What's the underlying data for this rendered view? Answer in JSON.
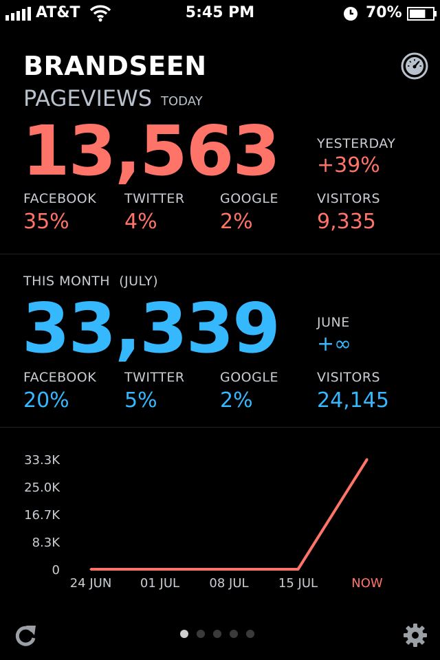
{
  "status_bar": {
    "carrier": "AT&T",
    "time": "5:45 PM",
    "battery_percent": "70%",
    "battery_level": 0.7,
    "signal_bars": 5
  },
  "header": {
    "title": "BRANDSEEN",
    "gauge_icon": "speedometer-icon"
  },
  "today": {
    "section_title": "PAGEVIEWS",
    "period_label": "TODAY",
    "pageviews": "13,563",
    "compare_label": "YESTERDAY",
    "compare_value": "+39%",
    "stats": [
      {
        "label": "FACEBOOK",
        "value": "35%"
      },
      {
        "label": "TWITTER",
        "value": "4%"
      },
      {
        "label": "GOOGLE",
        "value": "2%"
      },
      {
        "label": "VISITORS",
        "value": "9,335"
      }
    ]
  },
  "month": {
    "section_title": "THIS MONTH  (JULY)",
    "pageviews": "33,339",
    "compare_label": "JUNE",
    "compare_value": "+∞",
    "stats": [
      {
        "label": "FACEBOOK",
        "value": "20%"
      },
      {
        "label": "TWITTER",
        "value": "5%"
      },
      {
        "label": "GOOGLE",
        "value": "2%"
      },
      {
        "label": "VISITORS",
        "value": "24,145"
      }
    ]
  },
  "chart_data": {
    "type": "line",
    "x": [
      "24 JUN",
      "01 JUL",
      "08 JUL",
      "15 JUL",
      "NOW"
    ],
    "values": [
      0,
      0,
      0,
      0,
      33339
    ],
    "yticks": [
      "33.3K",
      "25.0K",
      "16.7K",
      "8.3K",
      "0"
    ],
    "ytick_values": [
      33300,
      25000,
      16700,
      8300,
      0
    ],
    "ylim": [
      0,
      33339
    ],
    "line_color": "#ff7468",
    "highlight_label_color": "#ff7468",
    "title": "",
    "xlabel": "",
    "ylabel": ""
  },
  "pager": {
    "pages": 5,
    "active": 0
  },
  "footer": {
    "refresh_icon": "refresh-icon",
    "settings_icon": "gear-icon"
  },
  "colors": {
    "today_accent": "#ff7468",
    "month_accent": "#36b8ff",
    "label": "#c9ced4",
    "background": "#000000"
  }
}
